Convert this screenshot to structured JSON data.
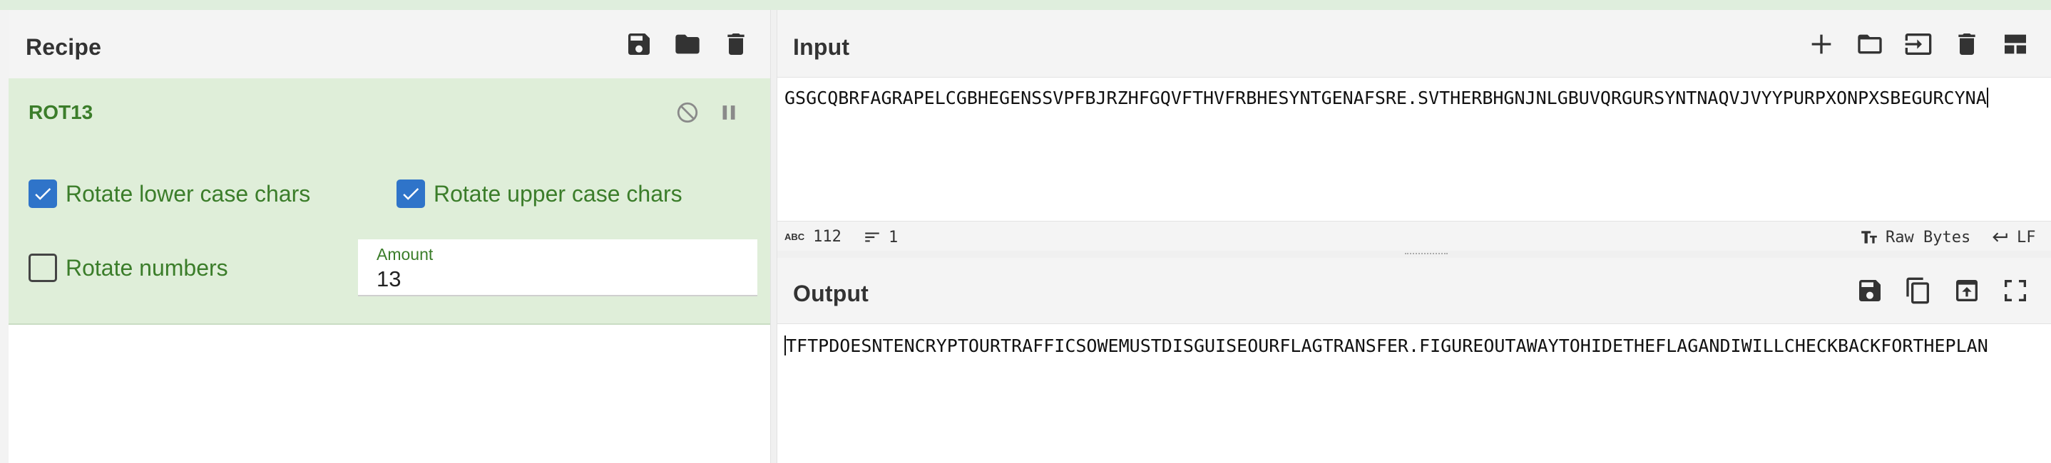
{
  "recipe": {
    "title": "Recipe",
    "icons": [
      "save-icon",
      "folder-icon",
      "trash-icon"
    ],
    "operation": {
      "name": "ROT13",
      "options": {
        "rotate_lower": {
          "label": "Rotate lower case chars",
          "checked": true
        },
        "rotate_upper": {
          "label": "Rotate upper case chars",
          "checked": true
        },
        "rotate_numbers": {
          "label": "Rotate numbers",
          "checked": false
        },
        "amount": {
          "label": "Amount",
          "value": "13"
        }
      }
    }
  },
  "input": {
    "title": "Input",
    "icons": [
      "plus-icon",
      "folder-icon",
      "import-icon",
      "trash-icon",
      "layout-icon"
    ],
    "text": "GSGCQBRFAGRAPELCGBHEGENSSVPFBJRZHFGQVFTHVFRBHESYNTGENAFSRE.SVTHERBHGNJNLGBUVQRGURSYNTNAQVJVYYPURPXONPXSBEGURCYNA",
    "status": {
      "length_tag": "ABC",
      "length": "112",
      "lines": "1",
      "encoding": "Raw Bytes",
      "eol": "LF"
    }
  },
  "output": {
    "title": "Output",
    "icons": [
      "save-icon",
      "copy-icon",
      "replace-input-icon",
      "maximize-icon"
    ],
    "text": "TFTPDOESNTENCRYPTOURTRAFFICSOWEMUSTDISGUISEOURFLAGTRANSFER.FIGUREOUTAWAYTOHIDETHEFLAGANDIWILLCHECKBACKFORTHEPLAN"
  },
  "colors": {
    "accent_green": "#3b7d2a",
    "op_background": "#dfeed9",
    "checkbox_blue": "#2f74c9"
  }
}
